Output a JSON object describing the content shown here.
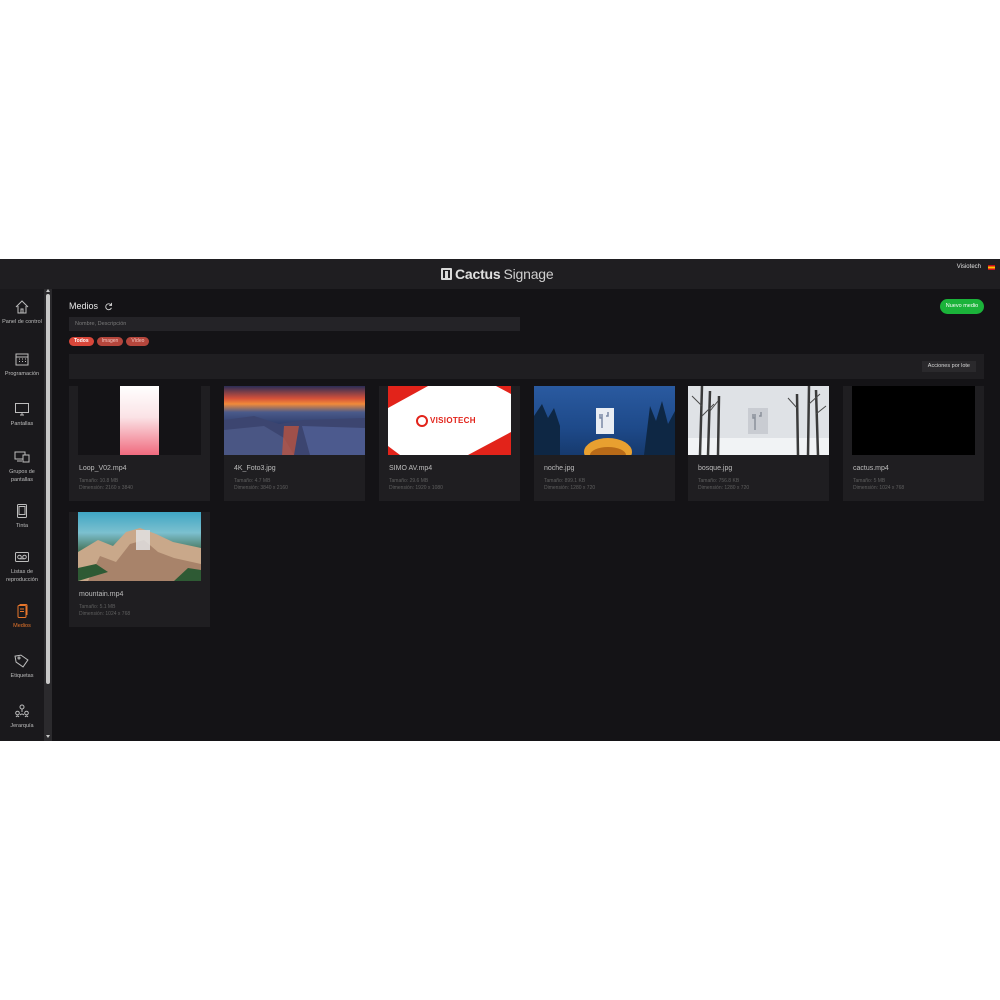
{
  "header": {
    "brand_bold": "Cactus",
    "brand_light": "Signage",
    "user": "Visiotech"
  },
  "sidebar": {
    "items": [
      {
        "label": "Panel de control",
        "icon": "home-icon"
      },
      {
        "label": "Programación",
        "icon": "calendar-icon"
      },
      {
        "label": "Pantallas",
        "icon": "monitor-icon"
      },
      {
        "label": "Grupos de pantallas",
        "icon": "screen-group-icon"
      },
      {
        "label": "Tinta",
        "icon": "tablet-icon"
      },
      {
        "label": "Listas de reproducción",
        "icon": "playlist-icon"
      },
      {
        "label": "Medios",
        "icon": "media-icon",
        "active": true
      },
      {
        "label": "Etiquetas",
        "icon": "tag-icon"
      },
      {
        "label": "Jerarquía",
        "icon": "hierarchy-icon"
      }
    ]
  },
  "main": {
    "title": "Medios",
    "search_placeholder": "Nombre, Descripción",
    "filters": [
      "Todos",
      "Imagen",
      "Vídeo"
    ],
    "active_filter": "Todos",
    "new_button": "Nuevo medio",
    "batch_button": "Acciones por lote",
    "size_label": "Tamaño:",
    "dims_label": "Dimensión:",
    "media": [
      {
        "name": "Loop_V02.mp4",
        "size": "10.8 MB",
        "dims": "2160 x 3840",
        "thumb": "pink-gradient-portrait"
      },
      {
        "name": "4K_Foto3.jpg",
        "size": "4.7 MB",
        "dims": "3840 x 2160",
        "thumb": "sunset-coast"
      },
      {
        "name": "SIMO AV.mp4",
        "size": "29.6 MB",
        "dims": "1920 x 1080",
        "thumb": "visiotech-logo"
      },
      {
        "name": "noche.jpg",
        "size": "899.1 KB",
        "dims": "1280 x 720",
        "thumb": "night-tower"
      },
      {
        "name": "bosque.jpg",
        "size": "756.8 KB",
        "dims": "1280 x 720",
        "thumb": "snow-forest"
      },
      {
        "name": "cactus.mp4",
        "size": "5 MB",
        "dims": "1024 x 768",
        "thumb": "black"
      },
      {
        "name": "mountain.mp4",
        "size": "5.1 MB",
        "dims": "1024 x 768",
        "thumb": "mountain-rocks"
      }
    ],
    "thumb_logo_text": "VISIOTECH"
  },
  "colors": {
    "accent": "#e8762b",
    "success": "#1bb33a",
    "chip": "#d9473a",
    "background": "#141316"
  }
}
